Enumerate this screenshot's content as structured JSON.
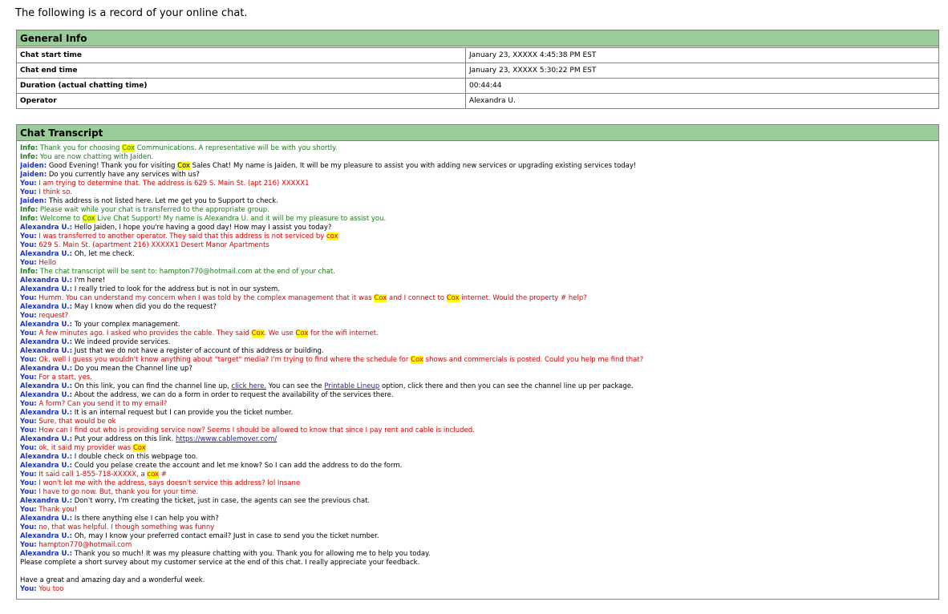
{
  "heading": "The following is a record of your online chat.",
  "general": {
    "title": "General Info",
    "rows": [
      {
        "label": "Chat start time",
        "value": "January 23, XXXXX 4:45:38 PM EST"
      },
      {
        "label": "Chat end time",
        "value": "January 23, XXXXX 5:30:22 PM EST"
      },
      {
        "label": "Duration (actual chatting time)",
        "value": "00:44:44"
      },
      {
        "label": "Operator",
        "value": "Alexandra U."
      }
    ]
  },
  "transcript": {
    "title": "Chat Transcript",
    "lines": [
      {
        "type": "info",
        "who": "Info:",
        "parts": [
          {
            "t": "Thank you for choosing "
          },
          {
            "t": "Cox",
            "hl": true
          },
          {
            "t": " Communications. A representative will be with you shortly."
          }
        ]
      },
      {
        "type": "info",
        "who": "Info:",
        "parts": [
          {
            "t": "You are now chatting with Jaiden."
          }
        ]
      },
      {
        "type": "agent",
        "who": "Jaiden:",
        "parts": [
          {
            "t": "Good Evening! Thank you for visiting "
          },
          {
            "t": "Cox",
            "hl": true
          },
          {
            "t": " Sales Chat! My name is Jaiden. It will be my pleasure to assist you with adding new services or upgrading existing services today!"
          }
        ]
      },
      {
        "type": "agent",
        "who": "Jaiden:",
        "parts": [
          {
            "t": "Do you currently have any services with us?"
          }
        ]
      },
      {
        "type": "you",
        "who": "You:",
        "parts": [
          {
            "t": "I am trying to determine that. The address is 629 S. Main St. (apt 216) XXXXX1"
          }
        ]
      },
      {
        "type": "you",
        "who": "You:",
        "parts": [
          {
            "t": "I think so."
          }
        ]
      },
      {
        "type": "agent",
        "who": "Jaiden:",
        "parts": [
          {
            "t": "This address is not listed here. Let me get you to Support to check."
          }
        ]
      },
      {
        "type": "info",
        "who": "Info:",
        "parts": [
          {
            "t": "Please wait while your chat is transferred to the appropriate group."
          }
        ]
      },
      {
        "type": "info",
        "who": "Info:",
        "parts": [
          {
            "t": "Welcome to "
          },
          {
            "t": "Cox",
            "hl": true
          },
          {
            "t": " Live Chat Support!  My name is Alexandra U. and it will be my pleasure to assist you."
          }
        ]
      },
      {
        "type": "agent",
        "who": "Alexandra U.:",
        "parts": [
          {
            "t": "Hello Jaiden, I hope you're having a good day! How may I assist you today?"
          }
        ]
      },
      {
        "type": "you",
        "who": "You:",
        "parts": [
          {
            "t": "I was transferred to another operator. They said that this address is not serviced by "
          },
          {
            "t": "cox",
            "hl": true
          }
        ]
      },
      {
        "type": "you",
        "who": "You:",
        "parts": [
          {
            "t": "629 S. Main St. (apartment 216) XXXXX1 Desert Manor Apartments"
          }
        ]
      },
      {
        "type": "agent",
        "who": "Alexandra U.:",
        "parts": [
          {
            "t": "Oh, let me check."
          }
        ]
      },
      {
        "type": "you",
        "who": "You:",
        "parts": [
          {
            "t": "Hello"
          }
        ]
      },
      {
        "type": "info",
        "who": "Info:",
        "parts": [
          {
            "t": "The chat transcript will be sent to: hampton770@hotmail.com at the end of your chat."
          }
        ]
      },
      {
        "type": "agent",
        "who": "Alexandra U.:",
        "parts": [
          {
            "t": "I'm here!"
          }
        ]
      },
      {
        "type": "agent",
        "who": "Alexandra U.:",
        "parts": [
          {
            "t": "I really tried to look for the address but is not in our system."
          }
        ]
      },
      {
        "type": "you",
        "who": "You:",
        "parts": [
          {
            "t": "Humm. You can understand my concern when I was told by the complex management that it was "
          },
          {
            "t": "Cox",
            "hl": true
          },
          {
            "t": " and I connect to "
          },
          {
            "t": "Cox",
            "hl": true
          },
          {
            "t": " internet. Would the property # help?"
          }
        ]
      },
      {
        "type": "agent",
        "who": "Alexandra U.:",
        "parts": [
          {
            "t": "May I know when did you do the request?"
          }
        ]
      },
      {
        "type": "you",
        "who": "You:",
        "parts": [
          {
            "t": "request?"
          }
        ]
      },
      {
        "type": "agent",
        "who": "Alexandra U.:",
        "parts": [
          {
            "t": "To your complex management."
          }
        ]
      },
      {
        "type": "you",
        "who": "You:",
        "parts": [
          {
            "t": "A few minutes ago. I asked who provides the cable. They said "
          },
          {
            "t": "Cox",
            "hl": true
          },
          {
            "t": ". We use "
          },
          {
            "t": "Cox",
            "hl": true
          },
          {
            "t": " for the wifi internet."
          }
        ]
      },
      {
        "type": "agent",
        "who": "Alexandra U.:",
        "parts": [
          {
            "t": "We indeed provide services."
          }
        ]
      },
      {
        "type": "agent",
        "who": "Alexandra U.:",
        "parts": [
          {
            "t": "Just that we do not have a register of account of this address or building."
          }
        ]
      },
      {
        "type": "you",
        "who": "You:",
        "parts": [
          {
            "t": "Ok, well I guess you wouldn't know anything about \"target\" media? I'm trying to find where the schedule for "
          },
          {
            "t": "Cox",
            "hl": true
          },
          {
            "t": " shows and commercials is posted. Could you help me find that?"
          }
        ]
      },
      {
        "type": "agent",
        "who": "Alexandra U.:",
        "parts": [
          {
            "t": "Do you mean the Channel line up?"
          }
        ]
      },
      {
        "type": "you",
        "who": "You:",
        "parts": [
          {
            "t": "For a start, yes."
          }
        ]
      },
      {
        "type": "agent",
        "who": "Alexandra U.:",
        "parts": [
          {
            "t": "On this link, you can find the channel line up, "
          },
          {
            "t": "click here.",
            "link": true
          },
          {
            "t": " You can see the "
          },
          {
            "t": "Printable Lineup",
            "link": true
          },
          {
            "t": " option, click there and then you can see the channel line up per package."
          }
        ]
      },
      {
        "type": "agent",
        "who": "Alexandra U.:",
        "parts": [
          {
            "t": "About the address, we can do a form in order to request the availability of the services there."
          }
        ]
      },
      {
        "type": "you",
        "who": "You:",
        "parts": [
          {
            "t": "A form? Can you send it to my email?"
          }
        ]
      },
      {
        "type": "agent",
        "who": "Alexandra U.:",
        "parts": [
          {
            "t": "It is an internal request but I can provide you the ticket number."
          }
        ]
      },
      {
        "type": "you",
        "who": "You:",
        "parts": [
          {
            "t": "Sure, that would be ok"
          }
        ]
      },
      {
        "type": "you",
        "who": "You:",
        "parts": [
          {
            "t": "How can I find out who is providing service now? Seems I should be allowed to know that since I pay rent and cable is included."
          }
        ]
      },
      {
        "type": "agent",
        "who": "Alexandra U.:",
        "parts": [
          {
            "t": "Put your address on this link. "
          },
          {
            "t": "https://www.cablemover.com/",
            "link": true
          }
        ]
      },
      {
        "type": "you",
        "who": "You:",
        "parts": [
          {
            "t": "ok, it said my provider was "
          },
          {
            "t": "Cox",
            "hl": true
          }
        ]
      },
      {
        "type": "agent",
        "who": "Alexandra U.:",
        "parts": [
          {
            "t": "I double check on this webpage too."
          }
        ]
      },
      {
        "type": "agent",
        "who": "Alexandra U.:",
        "parts": [
          {
            "t": "Could you pelase create the account and let me know? So I can add the address to do the form."
          }
        ]
      },
      {
        "type": "you",
        "who": "You:",
        "parts": [
          {
            "t": "It said call 1-855-718-XXXXX, a "
          },
          {
            "t": "cox",
            "hl": true
          },
          {
            "t": " #"
          }
        ]
      },
      {
        "type": "you",
        "who": "You:",
        "parts": [
          {
            "t": "I won't let me with the address, says doesn't service this address? lol Insane"
          }
        ]
      },
      {
        "type": "you",
        "who": "You:",
        "parts": [
          {
            "t": "I have to go now. But, thank you for your time."
          }
        ]
      },
      {
        "type": "agent",
        "who": "Alexandra U.:",
        "parts": [
          {
            "t": "Don't worry, I'm creating the ticket, just in case, the agents can see the previous  chat."
          }
        ]
      },
      {
        "type": "you",
        "who": "You:",
        "parts": [
          {
            "t": "Thank you!"
          }
        ]
      },
      {
        "type": "agent",
        "who": "Alexandra U.:",
        "parts": [
          {
            "t": "Is there anything else I can help you with?"
          }
        ]
      },
      {
        "type": "you",
        "who": "You:",
        "parts": [
          {
            "t": "no, that was helpful. I though something was funny"
          }
        ]
      },
      {
        "type": "agent",
        "who": "Alexandra U.:",
        "parts": [
          {
            "t": "Oh, may I know your preferred contact email? Just in case to send you the ticket number."
          }
        ]
      },
      {
        "type": "you",
        "who": "You:",
        "parts": [
          {
            "t": "hampton770@hotmail.com"
          }
        ]
      },
      {
        "type": "agent",
        "who": "Alexandra U.:",
        "parts": [
          {
            "t": "Thank you so much! It was my pleasure chatting with you. Thank you for allowing me to help you today."
          }
        ]
      },
      {
        "type": "plain",
        "who": "",
        "parts": [
          {
            "t": "Please complete a short survey about my customer service at the end of this chat. I really appreciate your feedback."
          }
        ]
      },
      {
        "type": "spacer"
      },
      {
        "type": "plain",
        "who": "",
        "parts": [
          {
            "t": "Have a great and amazing day and a wonderful week."
          }
        ]
      },
      {
        "type": "you",
        "who": "You:",
        "parts": [
          {
            "t": "You too"
          }
        ]
      }
    ]
  }
}
